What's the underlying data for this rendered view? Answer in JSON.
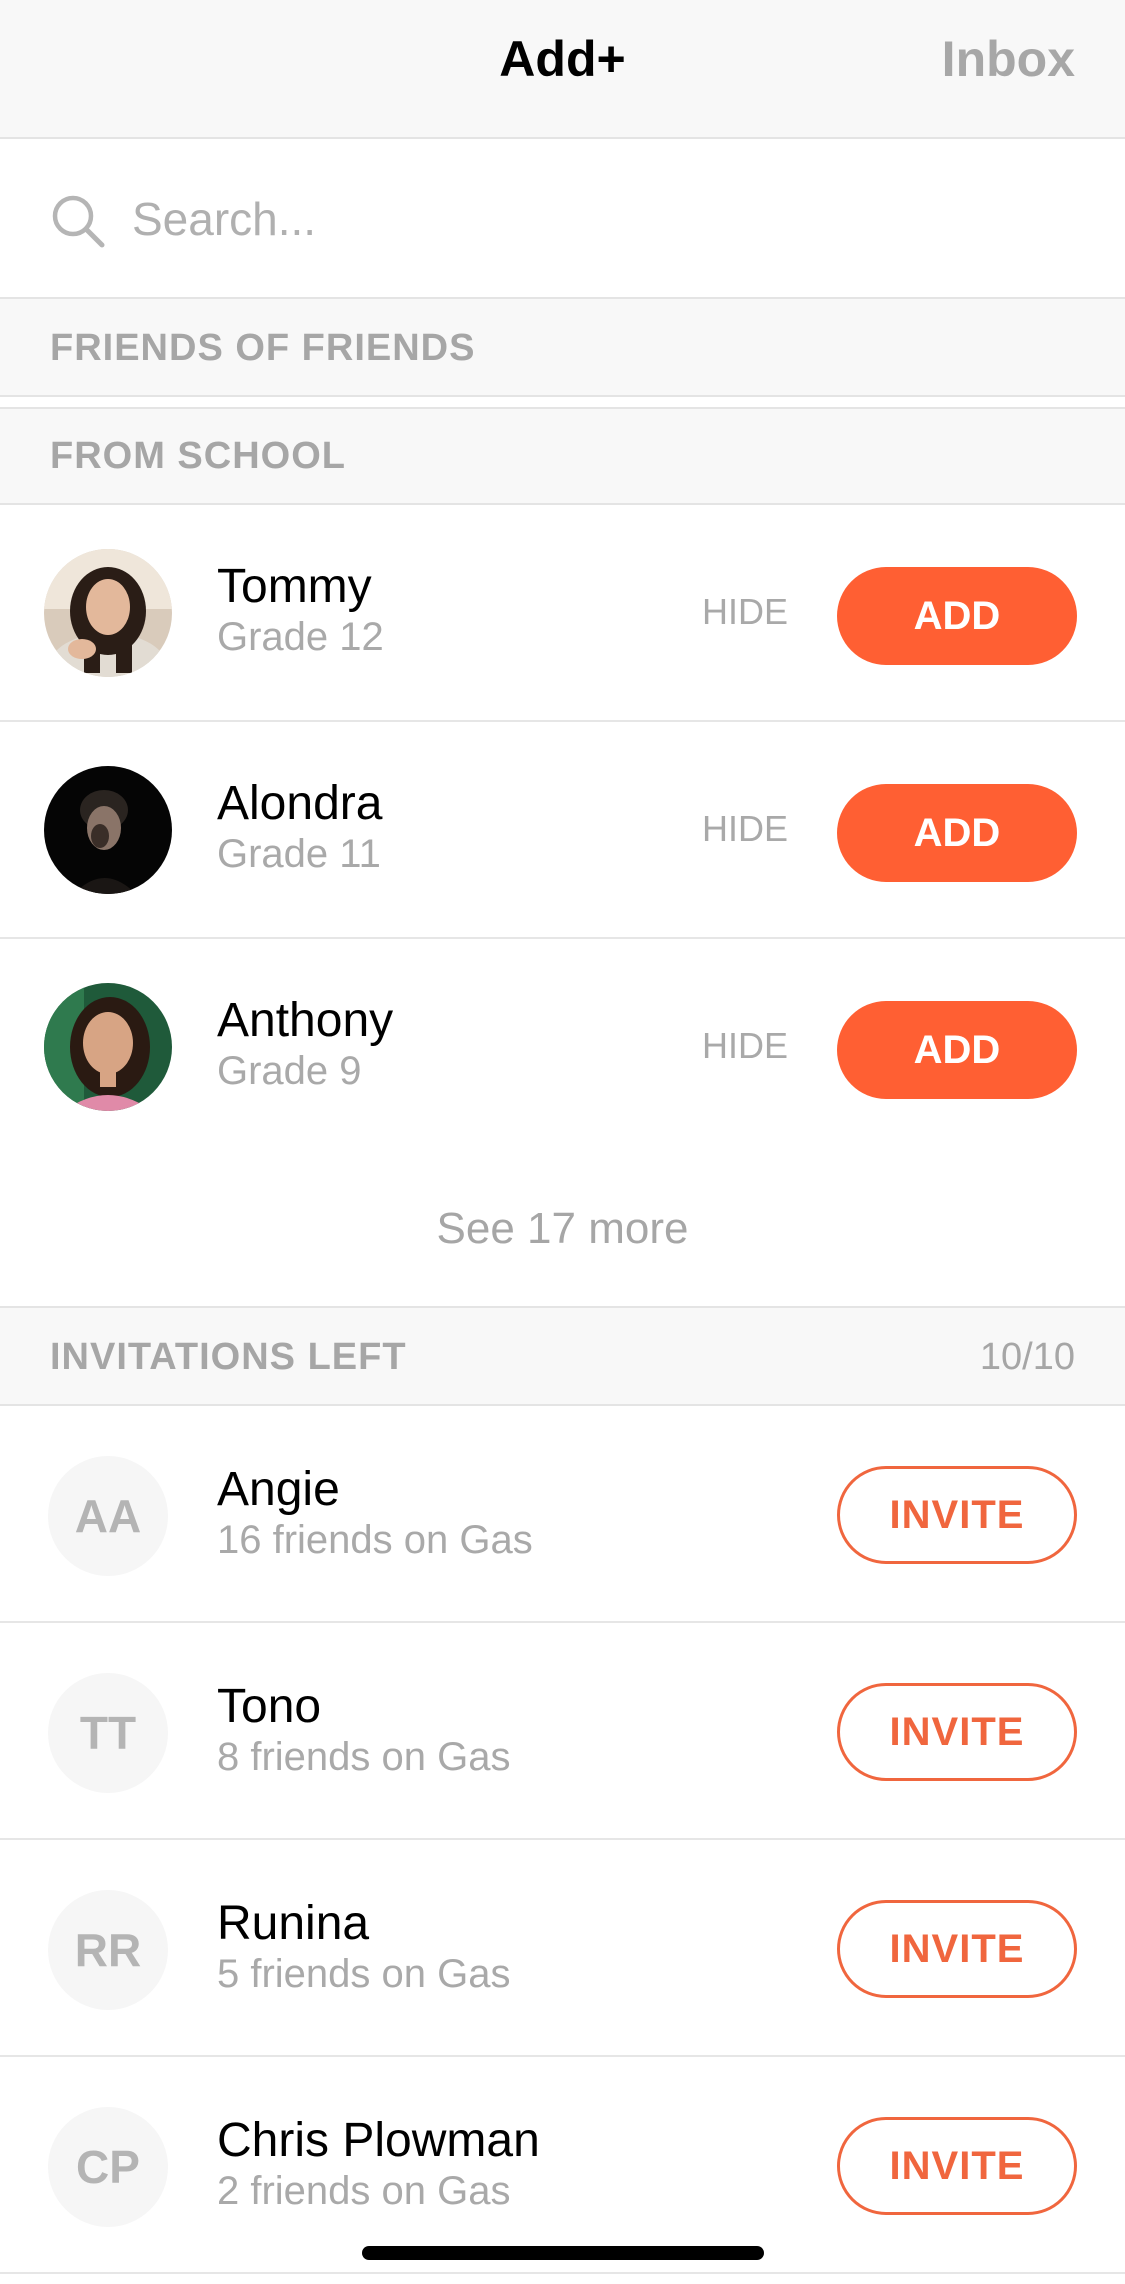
{
  "header": {
    "title": "Add+",
    "inbox_label": "Inbox"
  },
  "search": {
    "placeholder": "Search...",
    "value": ""
  },
  "sections": {
    "friends_of_friends": "FRIENDS OF FRIENDS",
    "from_school": "FROM SCHOOL",
    "invitations": {
      "label": "INVITATIONS LEFT",
      "count": "10/10"
    }
  },
  "school": [
    {
      "name": "Tommy",
      "grade": "Grade 12",
      "hide": "HIDE",
      "add": "ADD"
    },
    {
      "name": "Alondra",
      "grade": "Grade 11",
      "hide": "HIDE",
      "add": "ADD"
    },
    {
      "name": "Anthony",
      "grade": "Grade 9",
      "hide": "HIDE",
      "add": "ADD"
    }
  ],
  "see_more": "See 17 more",
  "invites": [
    {
      "initials": "AA",
      "name": "Angie",
      "friends": "16 friends on Gas",
      "button": "INVITE"
    },
    {
      "initials": "TT",
      "name": "Tono",
      "friends": "8 friends on Gas",
      "button": "INVITE"
    },
    {
      "initials": "RR",
      "name": "Runina",
      "friends": "5 friends on Gas",
      "button": "INVITE"
    },
    {
      "initials": "CP",
      "name": "Chris Plowman",
      "friends": "2 friends on Gas",
      "button": "INVITE"
    }
  ],
  "colors": {
    "accent": "#ff5f33",
    "invite_outline": "#f0663e",
    "muted_text": "#a6a6a6",
    "section_bg": "#f8f8f8"
  }
}
